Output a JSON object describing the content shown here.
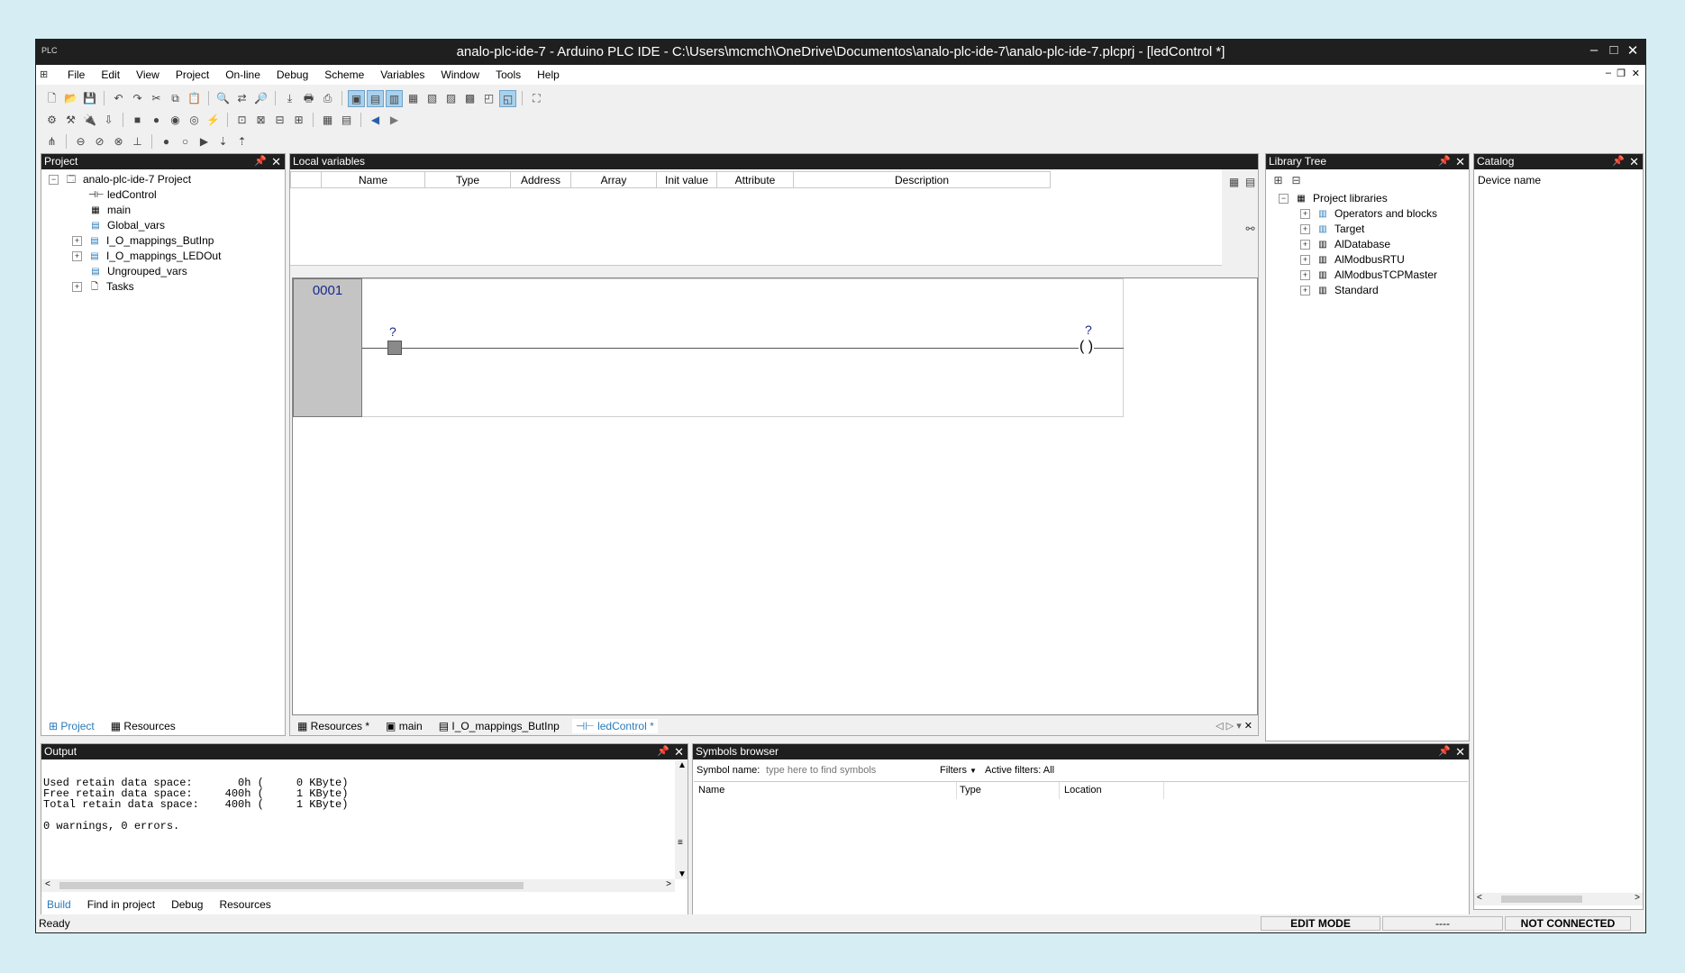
{
  "window": {
    "title": "analo-plc-ide-7 - Arduino PLC IDE - C:\\Users\\mcmch\\OneDrive\\Documentos\\analo-plc-ide-7\\analo-plc-ide-7.plcprj - [ledControl *]",
    "app_icon": "PLC",
    "minimize": "–",
    "maximize": "□",
    "close": "✕"
  },
  "menu": {
    "items": [
      "File",
      "Edit",
      "View",
      "Project",
      "On-line",
      "Debug",
      "Scheme",
      "Variables",
      "Window",
      "Tools",
      "Help"
    ]
  },
  "project_panel": {
    "title": "Project",
    "root": "analo-plc-ide-7 Project",
    "items": [
      "ledControl",
      "main",
      "Global_vars",
      "I_O_mappings_ButInp",
      "I_O_mappings_LEDOut",
      "Ungrouped_vars",
      "Tasks"
    ],
    "tabs": [
      "Project",
      "Resources"
    ]
  },
  "local_vars": {
    "title": "Local variables",
    "columns": [
      "Name",
      "Type",
      "Address",
      "Array",
      "Init value",
      "Attribute",
      "Description"
    ]
  },
  "ladder": {
    "network_number": "0001",
    "contact_label": "?",
    "coil_label": "?",
    "coil_symbol": "( )"
  },
  "editor_tabs": [
    "Resources *",
    "main",
    "I_O_mappings_ButInp",
    "ledControl *"
  ],
  "library_tree": {
    "title": "Library Tree",
    "root": "Project libraries",
    "items": [
      "Operators and blocks",
      "Target",
      "AlDatabase",
      "AlModbusRTU",
      "AlModbusTCPMaster",
      "Standard"
    ]
  },
  "catalog": {
    "title": "Catalog",
    "device_name_label": "Device name"
  },
  "output": {
    "title": "Output",
    "lines": [
      "Used retain data space:       0h (     0 KByte)",
      "Free retain data space:     400h (     1 KByte)",
      "Total retain data space:    400h (     1 KByte)",
      "",
      "0 warnings, 0 errors."
    ],
    "tabs": [
      "Build",
      "Find in project",
      "Debug",
      "Resources"
    ]
  },
  "symbols": {
    "title": "Symbols browser",
    "symbol_name_label": "Symbol name:",
    "search_placeholder": "type here to find symbols",
    "filters_label": "Filters",
    "active_filters": "Active filters: All",
    "columns": [
      "Name",
      "Type",
      "Location"
    ]
  },
  "status": {
    "left": "Ready",
    "mode": "EDIT MODE",
    "middle": "----",
    "connection": "NOT CONNECTED"
  },
  "icons": {
    "pin": "pin-icon",
    "close": "close-icon",
    "expand": "expand-icon",
    "collapse": "collapse-icon"
  }
}
